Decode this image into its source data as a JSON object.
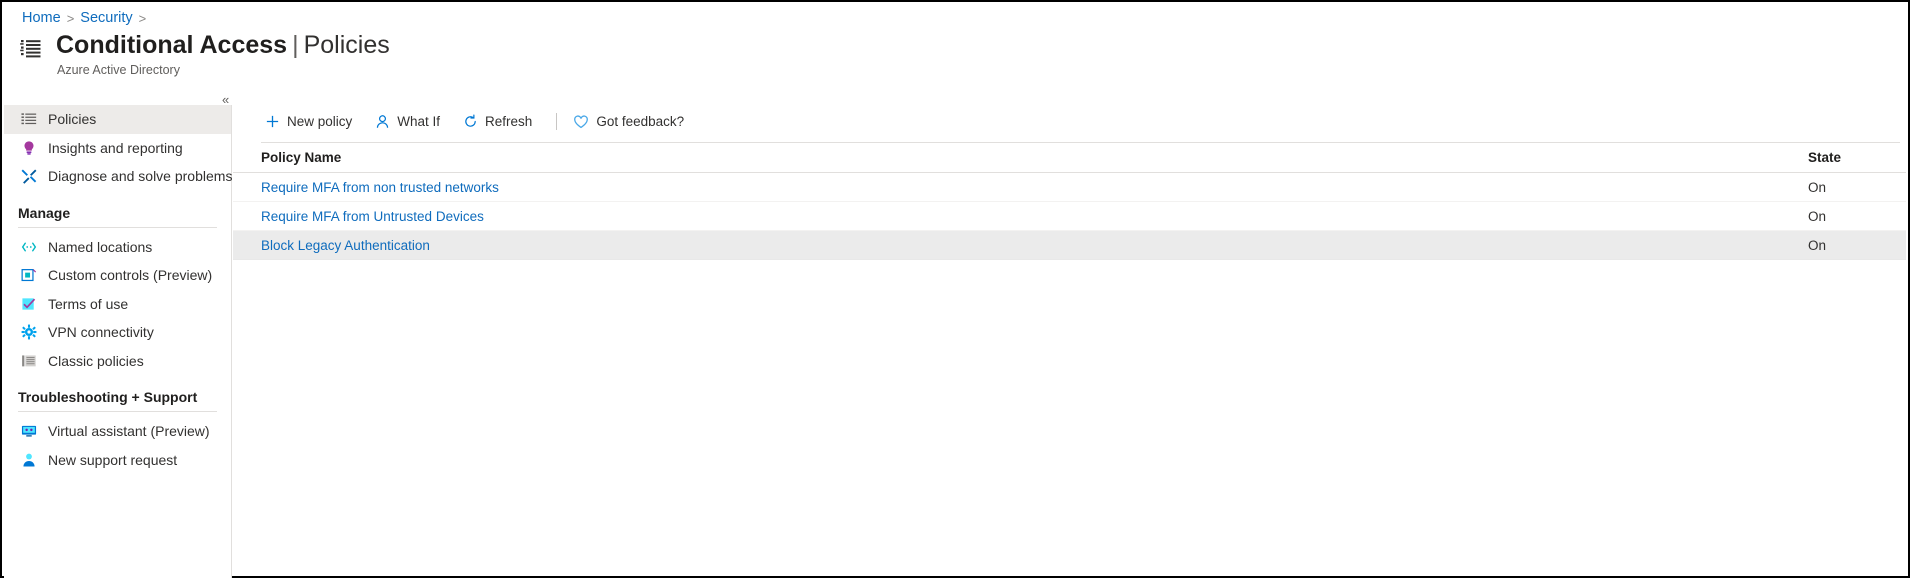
{
  "breadcrumb": {
    "items": [
      {
        "label": "Home"
      },
      {
        "label": "Security"
      }
    ],
    "separator": ">"
  },
  "header": {
    "title": "Conditional Access",
    "separator": "|",
    "section": "Policies",
    "subtitle": "Azure Active Directory",
    "icon": "list-policies-icon"
  },
  "sidebar": {
    "collapse_label": "«",
    "items": [
      {
        "label": "Policies",
        "icon": "list-icon",
        "selected": true
      },
      {
        "label": "Insights and reporting",
        "icon": "lightbulb-icon",
        "selected": false
      },
      {
        "label": "Diagnose and solve problems",
        "icon": "wrench-screwdriver-icon",
        "selected": false
      }
    ],
    "groups": [
      {
        "title": "Manage",
        "items": [
          {
            "label": "Named locations",
            "icon": "code-brackets-icon"
          },
          {
            "label": "Custom controls (Preview)",
            "icon": "square-in-square-icon"
          },
          {
            "label": "Terms of use",
            "icon": "checkbox-checked-icon"
          },
          {
            "label": "VPN connectivity",
            "icon": "gear-icon"
          },
          {
            "label": "Classic policies",
            "icon": "list-gray-icon"
          }
        ]
      },
      {
        "title": "Troubleshooting + Support",
        "items": [
          {
            "label": "Virtual assistant (Preview)",
            "icon": "monitor-assistant-icon"
          },
          {
            "label": "New support request",
            "icon": "person-support-icon"
          }
        ]
      }
    ]
  },
  "toolbar": {
    "buttons": [
      {
        "label": "New policy",
        "icon": "plus-icon"
      },
      {
        "label": "What If",
        "icon": "person-icon"
      },
      {
        "label": "Refresh",
        "icon": "refresh-icon"
      },
      {
        "label": "Got feedback?",
        "icon": "heart-icon"
      }
    ]
  },
  "table": {
    "columns": [
      "Policy Name",
      "State"
    ],
    "rows": [
      {
        "name": "Require MFA from non trusted networks",
        "state": "On",
        "highlight": false
      },
      {
        "name": "Require MFA from Untrusted Devices",
        "state": "On",
        "highlight": false
      },
      {
        "name": "Block Legacy Authentication",
        "state": "On",
        "highlight": true
      }
    ]
  },
  "colors": {
    "accent": "#0078d4",
    "link": "#0f6cbd",
    "selected_row": "#ebebeb",
    "selected_nav": "#edebe9"
  }
}
